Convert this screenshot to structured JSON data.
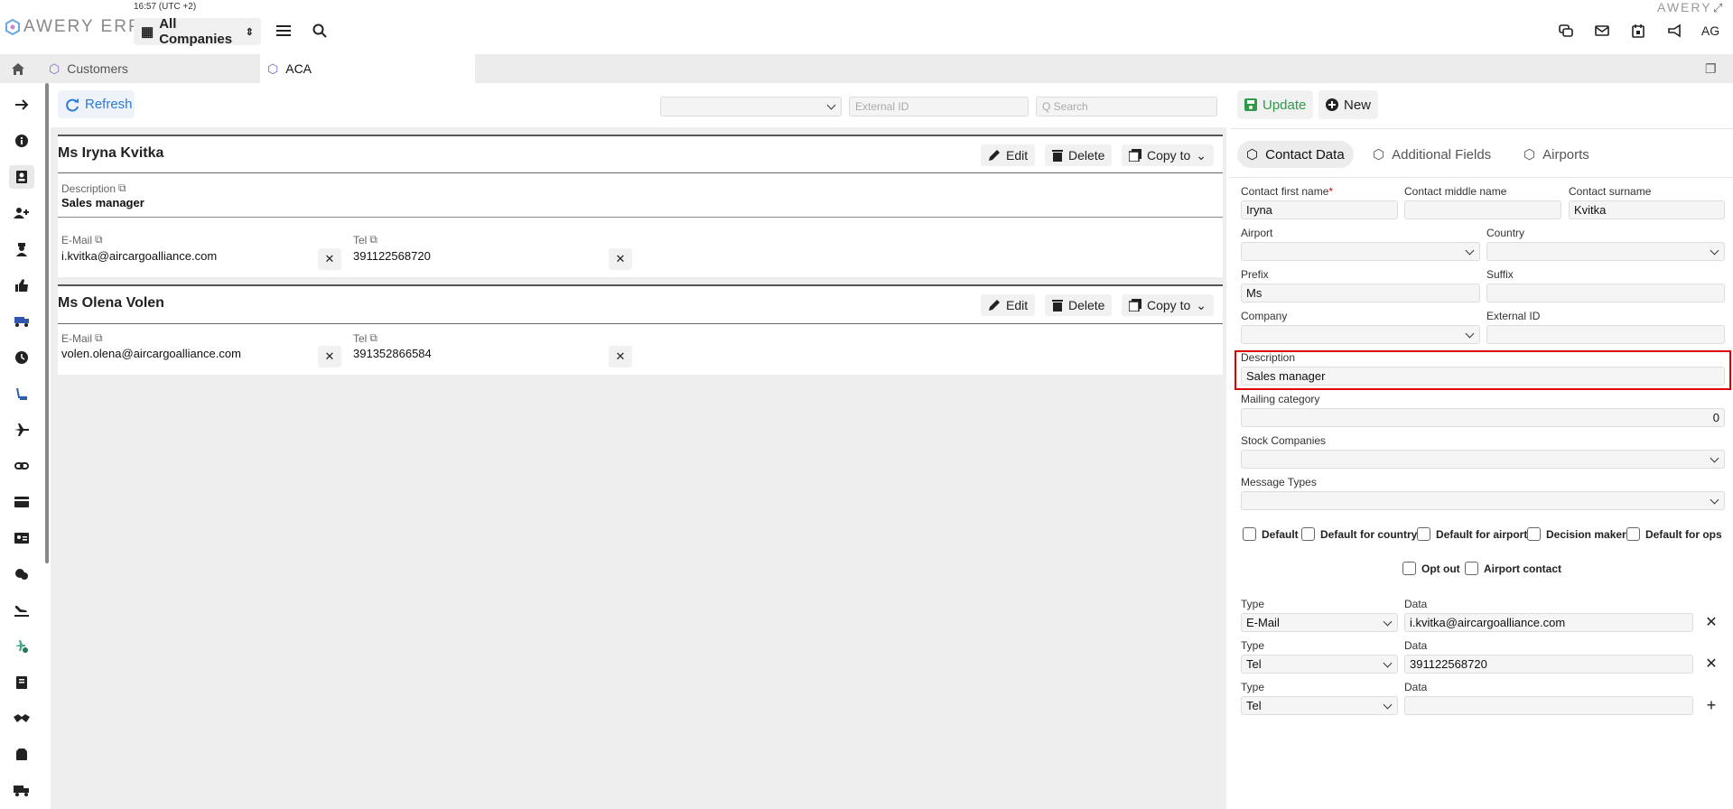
{
  "header": {
    "time": "16:57 (UTC +2)",
    "logo": "AWERY ERP",
    "brand_right": "AWERY",
    "company_select": "All Companies",
    "user_initials": "AG"
  },
  "tabs": [
    {
      "label": "Customers"
    },
    {
      "label": "ACA"
    }
  ],
  "toolbar": {
    "refresh": "Refresh",
    "external_id_placeholder": "External ID",
    "search_placeholder": "Q  Search"
  },
  "contacts": [
    {
      "name": "Ms Iryna Kvitka",
      "description_label": "Description",
      "description": "Sales manager",
      "email_label": "E-Mail",
      "email": "i.kvitka@aircargoalliance.com",
      "tel_label": "Tel",
      "tel": "391122568720"
    },
    {
      "name": "Ms Olena Volen",
      "email_label": "E-Mail",
      "email": "volen.olena@aircargoalliance.com",
      "tel_label": "Tel",
      "tel": "391352866584"
    }
  ],
  "card_buttons": {
    "edit": "Edit",
    "delete": "Delete",
    "copy_to": "Copy to"
  },
  "form": {
    "update": "Update",
    "new": "New",
    "tabs": [
      "Contact Data",
      "Additional Fields",
      "Airports"
    ],
    "first_name_label": "Contact first name",
    "first_name": "Iryna",
    "middle_name_label": "Contact middle name",
    "middle_name": "",
    "surname_label": "Contact surname",
    "surname": "Kvitka",
    "airport_label": "Airport",
    "country_label": "Country",
    "prefix_label": "Prefix",
    "prefix": "Ms",
    "suffix_label": "Suffix",
    "company_label": "Company",
    "external_id_label": "External ID",
    "description_label": "Description",
    "description": "Sales manager",
    "mailing_label": "Mailing category",
    "mailing": "0",
    "stock_label": "Stock Companies",
    "message_label": "Message Types",
    "checkboxes": [
      "Default",
      "Default for country",
      "Default for airport",
      "Decision maker",
      "Default for ops",
      "Opt out",
      "Airport contact"
    ],
    "type_label": "Type",
    "data_label": "Data",
    "rows": [
      {
        "type": "E-Mail",
        "data": "i.kvitka@aircargoalliance.com"
      },
      {
        "type": "Tel",
        "data": "391122568720"
      },
      {
        "type": "Tel",
        "data": ""
      }
    ]
  },
  "colors": {
    "accent": "#2b7bd8",
    "update_green": "#2e9a4a",
    "highlight": "#e00000"
  }
}
